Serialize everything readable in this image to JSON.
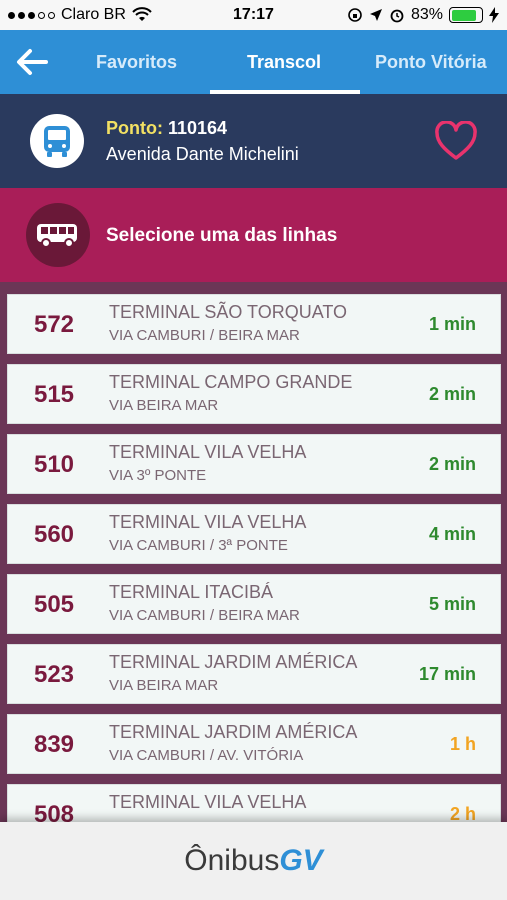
{
  "status_bar": {
    "carrier": "Claro BR",
    "time": "17:17",
    "battery": "83%",
    "battery_level": 0.83
  },
  "nav": {
    "tabs": [
      {
        "label": "Favoritos"
      },
      {
        "label": "Transcol"
      },
      {
        "label": "Ponto Vitória"
      }
    ],
    "active_tab": "Transcol"
  },
  "stop": {
    "label": "Ponto:",
    "number": "110164",
    "street": "Avenida Dante Michelini"
  },
  "select_section": {
    "title": "Selecione uma das linhas"
  },
  "lines": [
    {
      "code": "572",
      "destination": "TERMINAL SÃO TORQUATO",
      "via": "VIA CAMBURI / BEIRA MAR",
      "time": "1 min"
    },
    {
      "code": "515",
      "destination": "TERMINAL CAMPO GRANDE",
      "via": "VIA BEIRA MAR",
      "time": "2 min"
    },
    {
      "code": "510",
      "destination": "TERMINAL VILA VELHA",
      "via": "VIA 3º PONTE",
      "time": "2 min"
    },
    {
      "code": "560",
      "destination": "TERMINAL VILA VELHA",
      "via": "VIA CAMBURI / 3ª PONTE",
      "time": "4 min"
    },
    {
      "code": "505",
      "destination": "TERMINAL ITACIBÁ",
      "via": "VIA CAMBURI / BEIRA MAR",
      "time": "5 min"
    },
    {
      "code": "523",
      "destination": "TERMINAL JARDIM AMÉRICA",
      "via": "VIA BEIRA MAR",
      "time": "17 min"
    },
    {
      "code": "839",
      "destination": "TERMINAL JARDIM AMÉRICA",
      "via": "VIA CAMBURI / AV. VITÓRIA",
      "time": "1 h"
    },
    {
      "code": "508",
      "destination": "TERMINAL VILA VELHA",
      "via": "",
      "time": "2 h"
    }
  ],
  "footer": {
    "logo_text": "Ônibus",
    "logo_accent": "GV"
  },
  "colors": {
    "nav_blue": "#2e8fd6",
    "stop_navy": "#2a3a5e",
    "select_magenta": "#a91e58",
    "code_maroon": "#7a1a3e",
    "time_green": "#2e8a2e",
    "time_orange": "#f2a422"
  }
}
